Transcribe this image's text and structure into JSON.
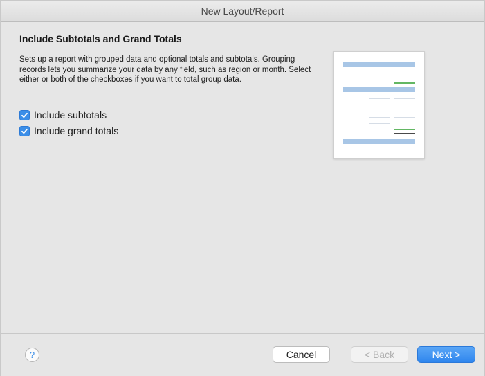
{
  "window": {
    "title": "New Layout/Report"
  },
  "content": {
    "heading": "Include Subtotals and Grand Totals",
    "description": "Sets up a report with grouped data and optional totals and subtotals. Grouping records lets you summarize your data by any field, such as region or month. Select either or both of the checkboxes if you want to total group data.",
    "checkboxes": [
      {
        "label": "Include subtotals",
        "checked": true
      },
      {
        "label": "Include grand totals",
        "checked": true
      }
    ],
    "preview_image": "report-layout-preview"
  },
  "footer": {
    "help_label": "?",
    "cancel_label": "Cancel",
    "back_label": "< Back",
    "back_enabled": false,
    "next_label": "Next >"
  },
  "colors": {
    "accent": "#3b8ee8",
    "preview_bar": "#a8c6e6",
    "preview_total": "#63b763"
  }
}
